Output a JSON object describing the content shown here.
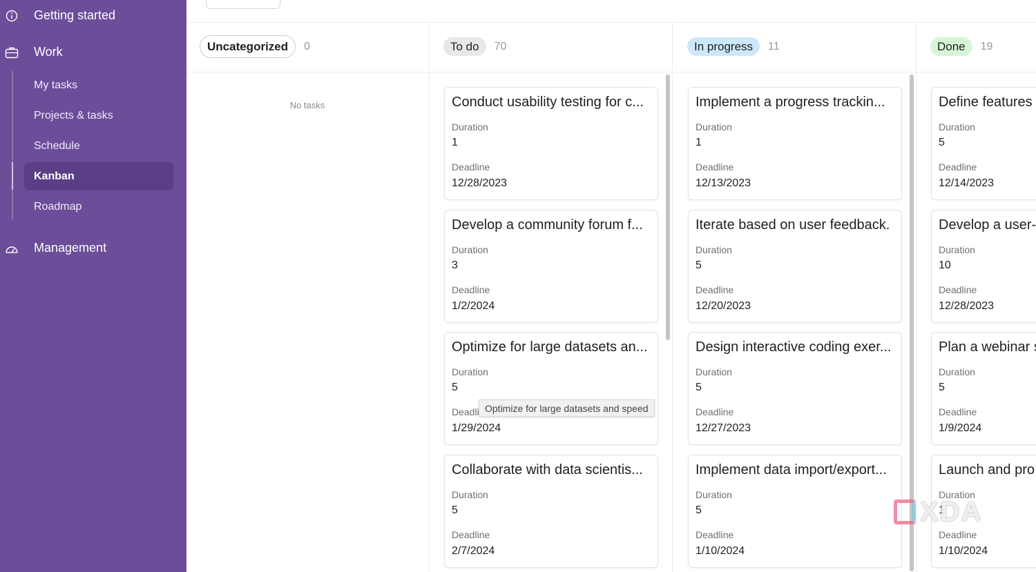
{
  "sidebar": {
    "getting_started": {
      "label": "Getting started",
      "icon": "info-circle-icon"
    },
    "work": {
      "label": "Work",
      "icon": "briefcase-icon",
      "items": [
        {
          "label": "My tasks",
          "active": false
        },
        {
          "label": "Projects & tasks",
          "active": false
        },
        {
          "label": "Schedule",
          "active": false
        },
        {
          "label": "Kanban",
          "active": true
        },
        {
          "label": "Roadmap",
          "active": false
        }
      ]
    },
    "management": {
      "label": "Management",
      "icon": "gauge-icon"
    }
  },
  "colors": {
    "sidebar_bg": "#6b4d99",
    "sidebar_active": "#5a3f86",
    "todo_badge": "#e8e8e8",
    "in_progress_badge": "#cde8fb",
    "done_badge": "#d6f5d6"
  },
  "board": {
    "columns": [
      {
        "name": "Uncategorized",
        "count": "0",
        "empty_text": "No tasks",
        "cards": []
      },
      {
        "name": "To do",
        "count": "70",
        "cards": [
          {
            "title": "Conduct usability testing for c...",
            "duration_label": "Duration",
            "duration": "1",
            "deadline_label": "Deadline",
            "deadline": "12/28/2023"
          },
          {
            "title": "Develop a community forum f...",
            "duration_label": "Duration",
            "duration": "3",
            "deadline_label": "Deadline",
            "deadline": "1/2/2024"
          },
          {
            "title": "Optimize for large datasets an...",
            "duration_label": "Duration",
            "duration": "5",
            "deadline_label": "Deadline",
            "deadline": "1/29/2024"
          },
          {
            "title": "Collaborate with data scientis...",
            "duration_label": "Duration",
            "duration": "5",
            "deadline_label": "Deadline",
            "deadline": "2/7/2024"
          }
        ]
      },
      {
        "name": "In progress",
        "count": "11",
        "cards": [
          {
            "title": "Implement a progress trackin...",
            "duration_label": "Duration",
            "duration": "1",
            "deadline_label": "Deadline",
            "deadline": "12/13/2023"
          },
          {
            "title": "Iterate based on user feedback.",
            "duration_label": "Duration",
            "duration": "5",
            "deadline_label": "Deadline",
            "deadline": "12/20/2023"
          },
          {
            "title": "Design interactive coding exer...",
            "duration_label": "Duration",
            "duration": "5",
            "deadline_label": "Deadline",
            "deadline": "12/27/2023"
          },
          {
            "title": "Implement data import/export...",
            "duration_label": "Duration",
            "duration": "5",
            "deadline_label": "Deadline",
            "deadline": "1/10/2024"
          }
        ]
      },
      {
        "name": "Done",
        "count": "19",
        "cards": [
          {
            "title": "Define features",
            "duration_label": "Duration",
            "duration": "5",
            "deadline_label": "Deadline",
            "deadline": "12/14/2023"
          },
          {
            "title": "Develop a user-",
            "duration_label": "Duration",
            "duration": "10",
            "deadline_label": "Deadline",
            "deadline": "12/28/2023"
          },
          {
            "title": "Plan a webinar s",
            "duration_label": "Duration",
            "duration": "5",
            "deadline_label": "Deadline",
            "deadline": "1/9/2024"
          },
          {
            "title": "Launch and pro",
            "duration_label": "Duration",
            "duration": "1",
            "deadline_label": "Deadline",
            "deadline": "1/10/2024"
          }
        ]
      }
    ]
  },
  "tooltip": {
    "text": "Optimize for large datasets and speed"
  },
  "watermark": {
    "text": "XDA"
  }
}
